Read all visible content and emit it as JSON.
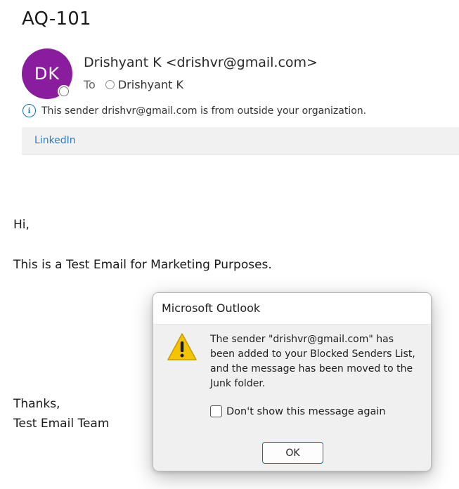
{
  "email": {
    "subject": "AQ-101",
    "avatar_initials": "DK",
    "avatar_color": "#8a1d9e",
    "sender": "Drishyant K <drishvr@gmail.com>",
    "to_label": "To",
    "recipient": "Drishyant K",
    "external_notice": "This sender drishvr@gmail.com is from outside your organization.",
    "banner_link": "LinkedIn",
    "body": {
      "greeting": "Hi,",
      "line1": "This is a Test Email for Marketing Purposes.",
      "signoff": "Thanks,",
      "signature": "Test Email Team"
    }
  },
  "dialog": {
    "title": "Microsoft Outlook",
    "icon": "warning-icon",
    "message": "The sender \"drishvr@gmail.com\" has been added to your Blocked Senders List, and the message has been moved to the Junk folder.",
    "checkbox_label": "Don't show this message again",
    "checkbox_checked": false,
    "ok_label": "OK",
    "accent_color": "#0f6cbd"
  }
}
